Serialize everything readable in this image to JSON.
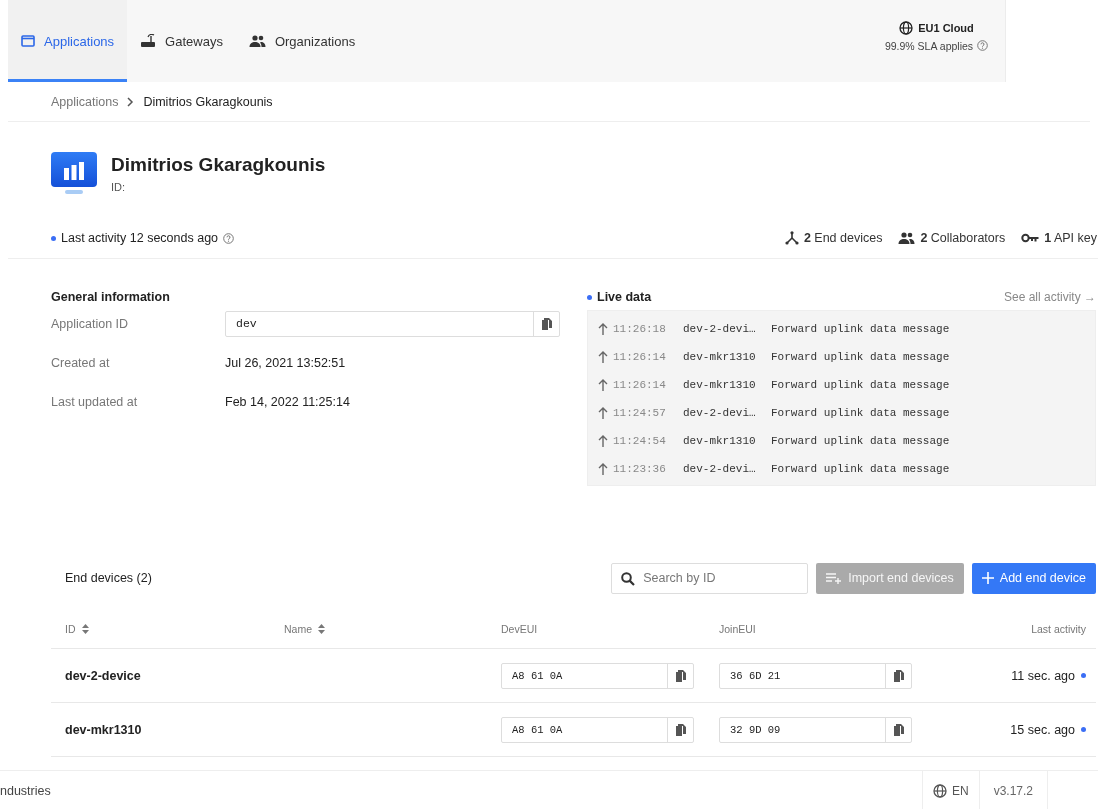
{
  "nav": {
    "tabs": [
      {
        "label": "Applications",
        "selected": true
      },
      {
        "label": "Gateways",
        "selected": false
      },
      {
        "label": "Organizations",
        "selected": false
      }
    ],
    "cluster": {
      "name": "EU1 Cloud",
      "sla": "99.9% SLA applies"
    }
  },
  "breadcrumbs": [
    "Applications",
    "Dimitrios Gkaragkounis"
  ],
  "header": {
    "title": "Dimitrios Gkaragkounis",
    "id_label": "ID:",
    "last_activity": "Last activity 12 seconds ago",
    "stats": [
      {
        "count": "2",
        "label": "End devices"
      },
      {
        "count": "2",
        "label": "Collaborators"
      },
      {
        "count": "1",
        "label": "API key"
      }
    ]
  },
  "general_information": {
    "title": "General information",
    "fields": [
      {
        "kind": "copy",
        "label": "Application ID",
        "value": "dev"
      },
      {
        "kind": "text",
        "label": "Created at",
        "value": "Jul 26, 2021 13:52:51"
      },
      {
        "kind": "text",
        "label": "Last updated at",
        "value": "Feb 14, 2022 11:25:14"
      }
    ]
  },
  "live_data": {
    "title": "Live data",
    "link": "See all activity →",
    "events": [
      {
        "time": "11:26:18",
        "device": "dev-2-devi…",
        "message": "Forward uplink data message"
      },
      {
        "time": "11:26:14",
        "device": "dev-mkr1310",
        "message": "Forward uplink data message"
      },
      {
        "time": "11:26:14",
        "device": "dev-mkr1310",
        "message": "Forward uplink data message"
      },
      {
        "time": "11:24:57",
        "device": "dev-2-devi…",
        "message": "Forward uplink data message"
      },
      {
        "time": "11:24:54",
        "device": "dev-mkr1310",
        "message": "Forward uplink data message"
      },
      {
        "time": "11:23:36",
        "device": "dev-2-devi…",
        "message": "Forward uplink data message"
      }
    ]
  },
  "end_devices": {
    "title": "End devices (2)",
    "search": {
      "placeholder": "Search by ID"
    },
    "buttons": [
      {
        "kind": "import",
        "label": "Import end devices",
        "disabled": true
      },
      {
        "kind": "add",
        "label": "Add end device",
        "disabled": false
      }
    ],
    "columns": [
      {
        "label": "ID",
        "sortable": true
      },
      {
        "label": "Name",
        "sortable": true
      },
      {
        "label": "DevEUI",
        "sortable": false
      },
      {
        "label": "JoinEUI",
        "sortable": false
      },
      {
        "label": "Last activity",
        "sortable": false
      }
    ],
    "rows": [
      {
        "id": "dev-2-device",
        "dev_eui": "A8 61 0A",
        "join_eui": "36 6D 21",
        "last_activity": "11 sec. ago"
      },
      {
        "id": "dev-mkr1310",
        "dev_eui": "A8 61 0A",
        "join_eui": "32 9D 09",
        "last_activity": "15 sec. ago"
      }
    ]
  },
  "footer": {
    "text": "ndustries",
    "language": "EN",
    "version": "v3.17.2"
  }
}
